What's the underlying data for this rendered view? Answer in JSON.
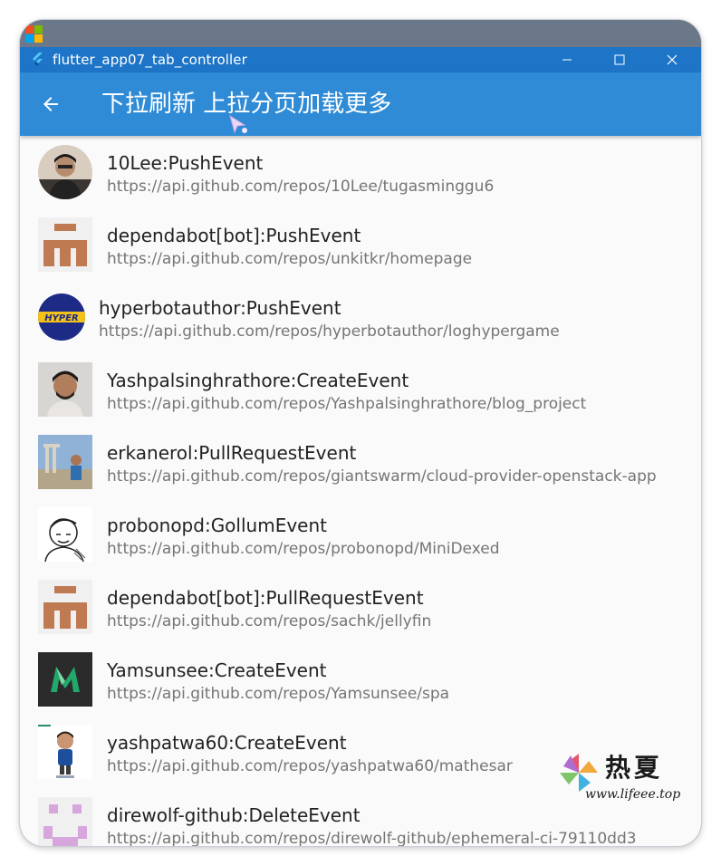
{
  "window": {
    "title": "flutter_app07_tab_controller"
  },
  "appbar": {
    "title": "下拉刷新 上拉分页加载更多"
  },
  "events": [
    {
      "title": "10Lee:PushEvent",
      "url": "https://api.github.com/repos/10Lee/tugasminggu6",
      "avatar": "photo-avatar"
    },
    {
      "title": "dependabot[bot]:PushEvent",
      "url": "https://api.github.com/repos/unkitkr/homepage",
      "avatar": "identicon-avatar"
    },
    {
      "title": "hyperbotauthor:PushEvent",
      "url": "https://api.github.com/repos/hyperbotauthor/loghypergame",
      "avatar": "hyper-logo-avatar"
    },
    {
      "title": "Yashpalsinghrathore:CreateEvent",
      "url": "https://api.github.com/repos/Yashpalsinghrathore/blog_project",
      "avatar": "photo-avatar"
    },
    {
      "title": "erkanerol:PullRequestEvent",
      "url": "https://api.github.com/repos/giantswarm/cloud-provider-openstack-app",
      "avatar": "photo-avatar"
    },
    {
      "title": "probonopd:GollumEvent",
      "url": "https://api.github.com/repos/probonopd/MiniDexed",
      "avatar": "sketch-avatar"
    },
    {
      "title": "dependabot[bot]:PullRequestEvent",
      "url": "https://api.github.com/repos/sachk/jellyfin",
      "avatar": "identicon-avatar"
    },
    {
      "title": "Yamsunsee:CreateEvent",
      "url": "https://api.github.com/repos/Yamsunsee/spa",
      "avatar": "m-logo-avatar"
    },
    {
      "title": "yashpatwa60:CreateEvent",
      "url": "https://api.github.com/repos/yashpatwa60/mathesar",
      "avatar": "cartoon-avatar"
    },
    {
      "title": "direwolf-github:DeleteEvent",
      "url": "https://api.github.com/repos/direwolf-github/ephemeral-ci-79110dd3",
      "avatar": "identicon-avatar"
    }
  ],
  "watermark": {
    "name": "热夏",
    "url": "www.lifeee.top"
  },
  "colors": {
    "titlebar": "#1e75c8",
    "appbar": "#2f8bd6",
    "list_bg": "#fafafa",
    "title_text": "#222222",
    "subtitle_text": "#757575",
    "identicon_brown": "#c07a52",
    "identicon_pink": "#d6a6dc"
  },
  "icons": {
    "window_icon": "flutter-icon",
    "minimize": "minimize-icon",
    "maximize": "maximize-icon",
    "close": "close-icon",
    "back": "arrow-back-icon"
  }
}
